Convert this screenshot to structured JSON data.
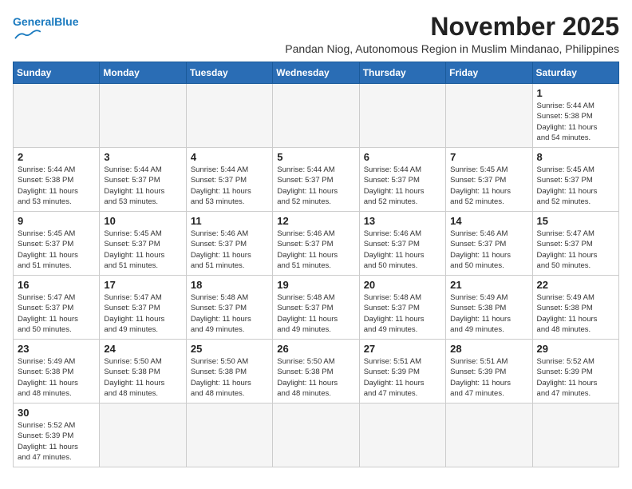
{
  "header": {
    "logo_line1": "General",
    "logo_line2": "Blue",
    "month": "November 2025",
    "location": "Pandan Niog, Autonomous Region in Muslim Mindanao, Philippines"
  },
  "weekdays": [
    "Sunday",
    "Monday",
    "Tuesday",
    "Wednesday",
    "Thursday",
    "Friday",
    "Saturday"
  ],
  "weeks": [
    [
      {
        "day": "",
        "info": ""
      },
      {
        "day": "",
        "info": ""
      },
      {
        "day": "",
        "info": ""
      },
      {
        "day": "",
        "info": ""
      },
      {
        "day": "",
        "info": ""
      },
      {
        "day": "",
        "info": ""
      },
      {
        "day": "1",
        "info": "Sunrise: 5:44 AM\nSunset: 5:38 PM\nDaylight: 11 hours\nand 54 minutes."
      }
    ],
    [
      {
        "day": "2",
        "info": "Sunrise: 5:44 AM\nSunset: 5:38 PM\nDaylight: 11 hours\nand 53 minutes."
      },
      {
        "day": "3",
        "info": "Sunrise: 5:44 AM\nSunset: 5:37 PM\nDaylight: 11 hours\nand 53 minutes."
      },
      {
        "day": "4",
        "info": "Sunrise: 5:44 AM\nSunset: 5:37 PM\nDaylight: 11 hours\nand 53 minutes."
      },
      {
        "day": "5",
        "info": "Sunrise: 5:44 AM\nSunset: 5:37 PM\nDaylight: 11 hours\nand 52 minutes."
      },
      {
        "day": "6",
        "info": "Sunrise: 5:44 AM\nSunset: 5:37 PM\nDaylight: 11 hours\nand 52 minutes."
      },
      {
        "day": "7",
        "info": "Sunrise: 5:45 AM\nSunset: 5:37 PM\nDaylight: 11 hours\nand 52 minutes."
      },
      {
        "day": "8",
        "info": "Sunrise: 5:45 AM\nSunset: 5:37 PM\nDaylight: 11 hours\nand 52 minutes."
      }
    ],
    [
      {
        "day": "9",
        "info": "Sunrise: 5:45 AM\nSunset: 5:37 PM\nDaylight: 11 hours\nand 51 minutes."
      },
      {
        "day": "10",
        "info": "Sunrise: 5:45 AM\nSunset: 5:37 PM\nDaylight: 11 hours\nand 51 minutes."
      },
      {
        "day": "11",
        "info": "Sunrise: 5:46 AM\nSunset: 5:37 PM\nDaylight: 11 hours\nand 51 minutes."
      },
      {
        "day": "12",
        "info": "Sunrise: 5:46 AM\nSunset: 5:37 PM\nDaylight: 11 hours\nand 51 minutes."
      },
      {
        "day": "13",
        "info": "Sunrise: 5:46 AM\nSunset: 5:37 PM\nDaylight: 11 hours\nand 50 minutes."
      },
      {
        "day": "14",
        "info": "Sunrise: 5:46 AM\nSunset: 5:37 PM\nDaylight: 11 hours\nand 50 minutes."
      },
      {
        "day": "15",
        "info": "Sunrise: 5:47 AM\nSunset: 5:37 PM\nDaylight: 11 hours\nand 50 minutes."
      }
    ],
    [
      {
        "day": "16",
        "info": "Sunrise: 5:47 AM\nSunset: 5:37 PM\nDaylight: 11 hours\nand 50 minutes."
      },
      {
        "day": "17",
        "info": "Sunrise: 5:47 AM\nSunset: 5:37 PM\nDaylight: 11 hours\nand 49 minutes."
      },
      {
        "day": "18",
        "info": "Sunrise: 5:48 AM\nSunset: 5:37 PM\nDaylight: 11 hours\nand 49 minutes."
      },
      {
        "day": "19",
        "info": "Sunrise: 5:48 AM\nSunset: 5:37 PM\nDaylight: 11 hours\nand 49 minutes."
      },
      {
        "day": "20",
        "info": "Sunrise: 5:48 AM\nSunset: 5:37 PM\nDaylight: 11 hours\nand 49 minutes."
      },
      {
        "day": "21",
        "info": "Sunrise: 5:49 AM\nSunset: 5:38 PM\nDaylight: 11 hours\nand 49 minutes."
      },
      {
        "day": "22",
        "info": "Sunrise: 5:49 AM\nSunset: 5:38 PM\nDaylight: 11 hours\nand 48 minutes."
      }
    ],
    [
      {
        "day": "23",
        "info": "Sunrise: 5:49 AM\nSunset: 5:38 PM\nDaylight: 11 hours\nand 48 minutes."
      },
      {
        "day": "24",
        "info": "Sunrise: 5:50 AM\nSunset: 5:38 PM\nDaylight: 11 hours\nand 48 minutes."
      },
      {
        "day": "25",
        "info": "Sunrise: 5:50 AM\nSunset: 5:38 PM\nDaylight: 11 hours\nand 48 minutes."
      },
      {
        "day": "26",
        "info": "Sunrise: 5:50 AM\nSunset: 5:38 PM\nDaylight: 11 hours\nand 48 minutes."
      },
      {
        "day": "27",
        "info": "Sunrise: 5:51 AM\nSunset: 5:39 PM\nDaylight: 11 hours\nand 47 minutes."
      },
      {
        "day": "28",
        "info": "Sunrise: 5:51 AM\nSunset: 5:39 PM\nDaylight: 11 hours\nand 47 minutes."
      },
      {
        "day": "29",
        "info": "Sunrise: 5:52 AM\nSunset: 5:39 PM\nDaylight: 11 hours\nand 47 minutes."
      }
    ],
    [
      {
        "day": "30",
        "info": "Sunrise: 5:52 AM\nSunset: 5:39 PM\nDaylight: 11 hours\nand 47 minutes."
      },
      {
        "day": "",
        "info": ""
      },
      {
        "day": "",
        "info": ""
      },
      {
        "day": "",
        "info": ""
      },
      {
        "day": "",
        "info": ""
      },
      {
        "day": "",
        "info": ""
      },
      {
        "day": "",
        "info": ""
      }
    ]
  ]
}
